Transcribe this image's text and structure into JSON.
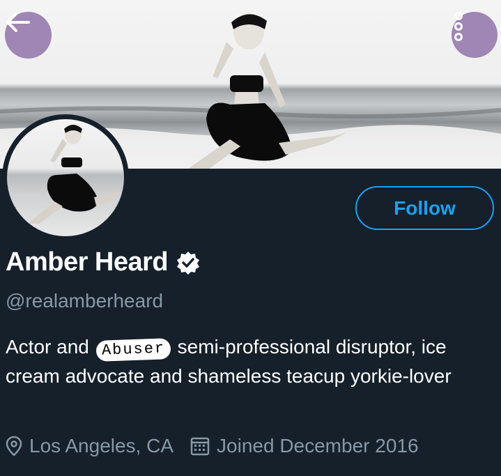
{
  "header": {
    "back_icon": "arrow-left-icon",
    "more_icon": "more-vertical-icon",
    "button_color": "#9f86b4"
  },
  "profile": {
    "name": "Amber Heard",
    "verified": true,
    "handle": "@realamberheard",
    "follow_label": "Follow",
    "bio_before": "Actor and",
    "bio_redaction": "Abuser",
    "bio_after": "semi-professional disruptor, ice cream advocate and shameless teacup yorkie-lover",
    "location": "Los Angeles, CA",
    "joined": "Joined December 2016"
  },
  "colors": {
    "background": "#15202b",
    "accent": "#1da1f2",
    "secondary_text": "#8899a6"
  }
}
